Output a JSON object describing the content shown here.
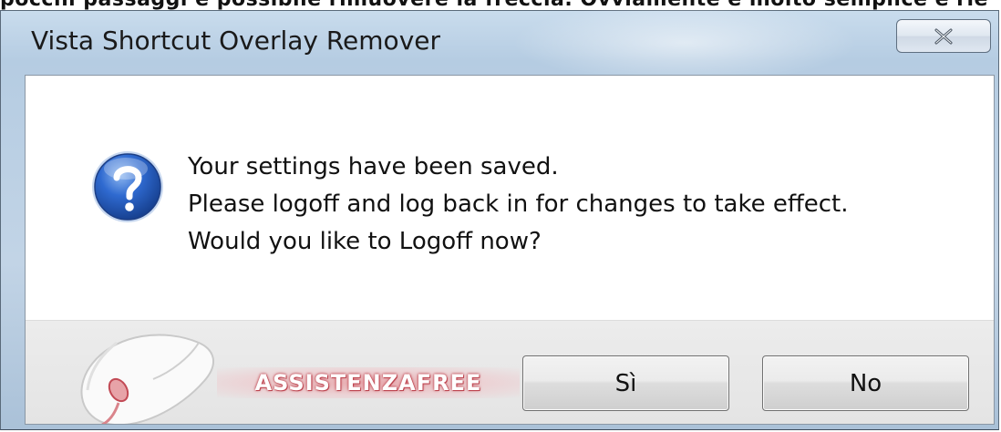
{
  "background_text": "pocchi passaggi è possibile rimuovere la freccia. Ovviamente è molto semplice e rie",
  "dialog": {
    "title": "Vista Shortcut Overlay Remover",
    "close_icon": "close-icon",
    "message_icon": "question-icon",
    "message_lines": [
      "Your settings have been saved.",
      "Please logoff and log back in for changes to take effect.",
      "Would you like to Logoff now?"
    ],
    "buttons": {
      "yes": "Sì",
      "no": "No"
    }
  },
  "watermark": {
    "logo_icon": "mouse-icon",
    "text": "ASSISTENZAFREE"
  },
  "colors": {
    "frame": "#b5cce2",
    "footer": "#e6e6e6",
    "icon_blue": "#1f4fa8",
    "brand_red": "#c24a55"
  }
}
